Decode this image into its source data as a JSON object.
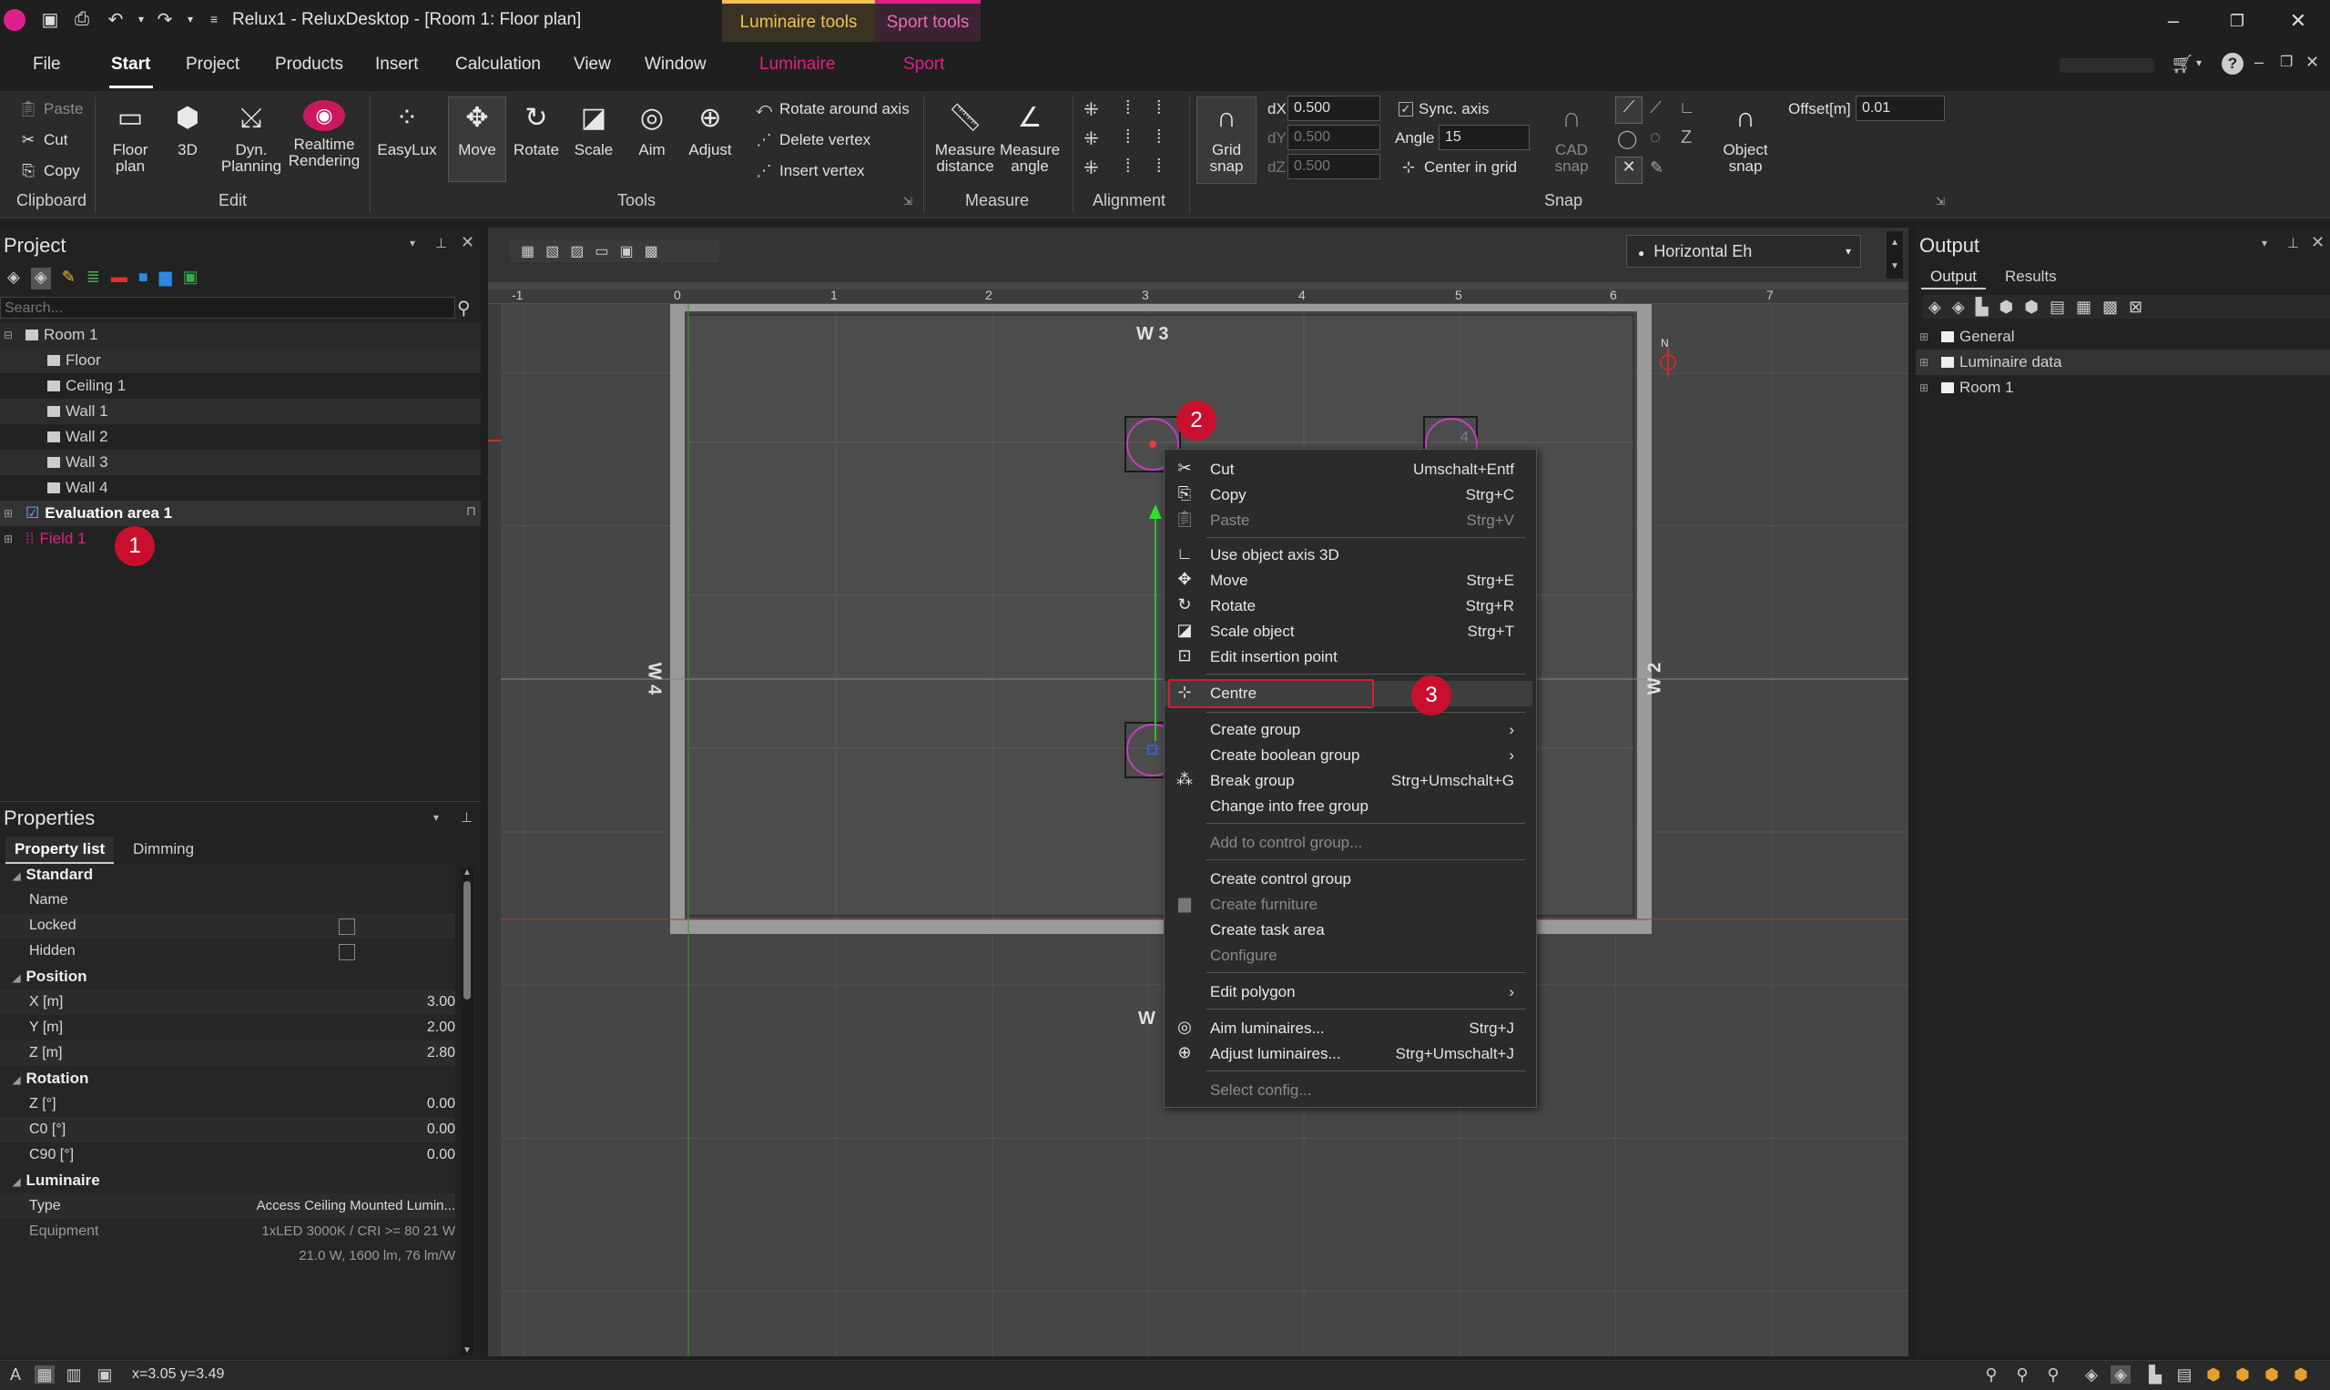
{
  "title": "Relux1 - ReluxDesktop - [Room 1: Floor plan]",
  "context_tabs": {
    "luminaire_tools": "Luminaire tools",
    "sport_tools": "Sport tools"
  },
  "menu": {
    "file": "File",
    "start": "Start",
    "project": "Project",
    "products": "Products",
    "insert": "Insert",
    "calculation": "Calculation",
    "view": "View",
    "window": "Window",
    "luminaire": "Luminaire",
    "sport": "Sport"
  },
  "ribbon": {
    "clipboard": {
      "paste": "Paste",
      "cut": "Cut",
      "copy": "Copy",
      "label": "Clipboard"
    },
    "edit": {
      "floor_plan": "Floor plan",
      "three_d": "3D",
      "dyn_planning": "Dyn. Planning",
      "realtime": "Realtime Rendering",
      "label": "Edit"
    },
    "tools": {
      "easylux": "EasyLux",
      "move": "Move",
      "rotate": "Rotate",
      "scale": "Scale",
      "aim": "Aim",
      "adjust": "Adjust",
      "rotate_axis": "Rotate around axis",
      "delete_vertex": "Delete vertex",
      "insert_vertex": "Insert vertex",
      "label": "Tools"
    },
    "measure": {
      "distance": "Measure distance",
      "angle": "Measure angle",
      "label": "Measure"
    },
    "alignment": {
      "label": "Alignment"
    },
    "snap": {
      "grid_snap": "Grid snap",
      "dx_label": "dX",
      "dx": "0.500",
      "dy_label": "dY",
      "dy": "0.500",
      "dz_label": "dZ",
      "dz": "0.500",
      "sync_axis": "Sync. axis",
      "angle_label": "Angle",
      "angle": "15",
      "center_grid": "Center in grid",
      "cad_snap": "CAD snap",
      "object_snap": "Object snap",
      "offset_label": "Offset[m]",
      "offset": "0.01",
      "label": "Snap"
    }
  },
  "project": {
    "title": "Project",
    "search_placeholder": "Search...",
    "tree": [
      "Room 1",
      "Floor",
      "Ceiling 1",
      "Wall 1",
      "Wall 2",
      "Wall 3",
      "Wall 4",
      "Evaluation area 1",
      "Field 1"
    ]
  },
  "properties": {
    "title": "Properties",
    "tabs": [
      "Property list",
      "Dimming"
    ],
    "sections": {
      "standard": "Standard",
      "position": "Position",
      "rotation": "Rotation",
      "luminaire": "Luminaire"
    },
    "rows": {
      "name": "Name",
      "locked": "Locked",
      "hidden": "Hidden",
      "x": "X [m]",
      "x_val": "3.00",
      "y": "Y [m]",
      "y_val": "2.00",
      "z": "Z [m]",
      "z_val": "2.80",
      "rz": "Z [°]",
      "rz_val": "0.00",
      "c0": "C0 [°]",
      "c0_val": "0.00",
      "c90": "C90 [°]",
      "c90_val": "0.00",
      "type": "Type",
      "type_val": "Access Ceiling Mounted Lumin...",
      "equipment": "Equipment",
      "equipment_val": "1xLED 3000K / CRI >= 80 21 W",
      "equipment_val2": "21.0 W, 1600 lm, 76 lm/W"
    }
  },
  "view": {
    "dropdown": "Horizontal Eh",
    "ruler_x": [
      "-1",
      "0",
      "1",
      "2",
      "3",
      "4",
      "5",
      "6",
      "7"
    ],
    "walls": {
      "w1": "W",
      "w2": "W 2",
      "w3": "W 3",
      "w4": "W 4"
    },
    "north": "N",
    "lum_labels": [
      "2",
      "4"
    ]
  },
  "output": {
    "title": "Output",
    "tabs": [
      "Output",
      "Results"
    ],
    "tree": [
      "General",
      "Luminaire data",
      "Room 1"
    ]
  },
  "context_menu": [
    {
      "label": "Cut",
      "shortcut": "Umschalt+Entf",
      "icon": "scissors-icon"
    },
    {
      "label": "Copy",
      "shortcut": "Strg+C",
      "icon": "copy-icon"
    },
    {
      "label": "Paste",
      "shortcut": "Strg+V",
      "icon": "paste-icon",
      "disabled": true
    },
    {
      "label": "Use object axis 3D",
      "shortcut": "",
      "icon": "axis-icon"
    },
    {
      "label": "Move",
      "shortcut": "Strg+E",
      "icon": "move-icon"
    },
    {
      "label": "Rotate",
      "shortcut": "Strg+R",
      "icon": "rotate-icon"
    },
    {
      "label": "Scale object",
      "shortcut": "Strg+T",
      "icon": "scale-icon"
    },
    {
      "label": "Edit insertion point",
      "shortcut": "",
      "icon": "insertion-icon"
    },
    {
      "label": "Centre",
      "shortcut": "",
      "icon": "centre-icon"
    },
    {
      "label": "Create group",
      "shortcut": "›",
      "icon": ""
    },
    {
      "label": "Create boolean group",
      "shortcut": "›",
      "icon": ""
    },
    {
      "label": "Break group",
      "shortcut": "Strg+Umschalt+G",
      "icon": "break-icon"
    },
    {
      "label": "Change into free group",
      "shortcut": "",
      "icon": ""
    },
    {
      "label": "Add to control group...",
      "shortcut": "",
      "icon": "",
      "disabled": true
    },
    {
      "label": "Create control group",
      "shortcut": "",
      "icon": ""
    },
    {
      "label": "Create furniture",
      "shortcut": "",
      "icon": "furniture-icon",
      "disabled": true
    },
    {
      "label": "Create task area",
      "shortcut": "",
      "icon": ""
    },
    {
      "label": "Configure",
      "shortcut": "",
      "icon": "",
      "disabled": true
    },
    {
      "label": "Edit polygon",
      "shortcut": "›",
      "icon": ""
    },
    {
      "label": "Aim luminaires...",
      "shortcut": "Strg+J",
      "icon": "aim-icon"
    },
    {
      "label": "Adjust luminaires...",
      "shortcut": "Strg+Umschalt+J",
      "icon": "adjust-icon"
    },
    {
      "label": "Select config...",
      "shortcut": "",
      "icon": "",
      "disabled": true
    }
  ],
  "badges": [
    "1",
    "2",
    "3"
  ],
  "status": {
    "coords": "x=3.05 y=3.49"
  },
  "colors": {
    "accent_magenta": "#e0208a",
    "badge_red": "#c8102e",
    "luminaire_tools": "#f2c14e",
    "sport_tools": "#e0208a"
  }
}
